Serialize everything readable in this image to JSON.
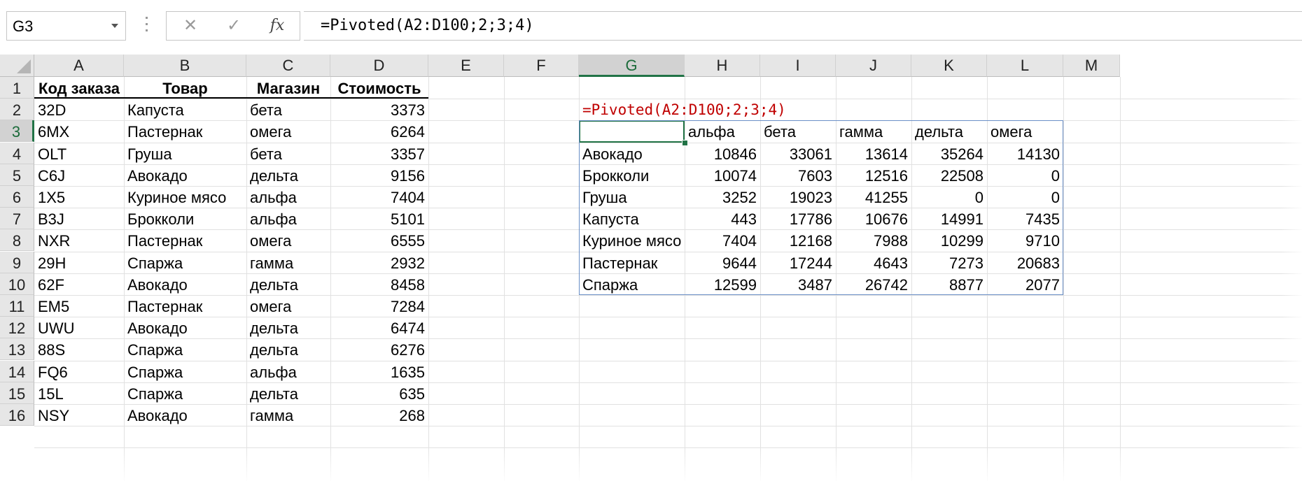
{
  "formula_bar": {
    "name_box": "G3",
    "cancel_icon": "✕",
    "enter_icon": "✓",
    "fx_icon": "fx",
    "formula": "=Pivoted(A2:D100;2;3;4)"
  },
  "columns": [
    "A",
    "B",
    "C",
    "D",
    "E",
    "F",
    "G",
    "H",
    "I",
    "J",
    "K",
    "L",
    "M"
  ],
  "rows": [
    "1",
    "2",
    "3",
    "4",
    "5",
    "6",
    "7",
    "8",
    "9",
    "10",
    "11",
    "12",
    "13",
    "14",
    "15",
    "16"
  ],
  "table": {
    "headers": [
      "Код заказа",
      "Товар",
      "Магазин",
      "Стоимость"
    ],
    "rows": [
      [
        "32D",
        "Капуста",
        "бета",
        "3373"
      ],
      [
        "6MX",
        "Пастернак",
        "омега",
        "6264"
      ],
      [
        "OLT",
        "Груша",
        "бета",
        "3357"
      ],
      [
        "C6J",
        "Авокадо",
        "дельта",
        "9156"
      ],
      [
        "1X5",
        "Куриное мясо",
        "альфа",
        "7404"
      ],
      [
        "B3J",
        "Брокколи",
        "альфа",
        "5101"
      ],
      [
        "NXR",
        "Пастернак",
        "омега",
        "6555"
      ],
      [
        "29H",
        "Спаржа",
        "гамма",
        "2932"
      ],
      [
        "62F",
        "Авокадо",
        "дельта",
        "8458"
      ],
      [
        "EM5",
        "Пастернак",
        "омега",
        "7284"
      ],
      [
        "UWU",
        "Авокадо",
        "дельта",
        "6474"
      ],
      [
        "88S",
        "Спаржа",
        "дельта",
        "6276"
      ],
      [
        "FQ6",
        "Спаржа",
        "альфа",
        "1635"
      ],
      [
        "15L",
        "Спаржа",
        "дельта",
        "635"
      ],
      [
        "NSY",
        "Авокадо",
        "гамма",
        "268"
      ]
    ]
  },
  "pivot": {
    "formula_text": "=Pivoted(A2:D100;2;3;4)",
    "col_headers": [
      "альфа",
      "бета",
      "гамма",
      "дельта",
      "омега"
    ],
    "rows": [
      {
        "label": "Авокадо",
        "values": [
          "10846",
          "33061",
          "13614",
          "35264",
          "14130"
        ]
      },
      {
        "label": "Брокколи",
        "values": [
          "10074",
          "7603",
          "12516",
          "22508",
          "0"
        ]
      },
      {
        "label": "Груша",
        "values": [
          "3252",
          "19023",
          "41255",
          "0",
          "0"
        ]
      },
      {
        "label": "Капуста",
        "values": [
          "443",
          "17786",
          "10676",
          "14991",
          "7435"
        ]
      },
      {
        "label": "Куриное мясо",
        "values": [
          "7404",
          "12168",
          "7988",
          "10299",
          "9710"
        ]
      },
      {
        "label": "Пастернак",
        "values": [
          "9644",
          "17244",
          "4643",
          "7273",
          "20683"
        ]
      },
      {
        "label": "Спаржа",
        "values": [
          "12599",
          "3487",
          "26742",
          "8877",
          "2077"
        ]
      }
    ]
  },
  "colors": {
    "selection": "#217346",
    "formula_red": "#c00000",
    "pivot_border": "#6a8fc7"
  }
}
